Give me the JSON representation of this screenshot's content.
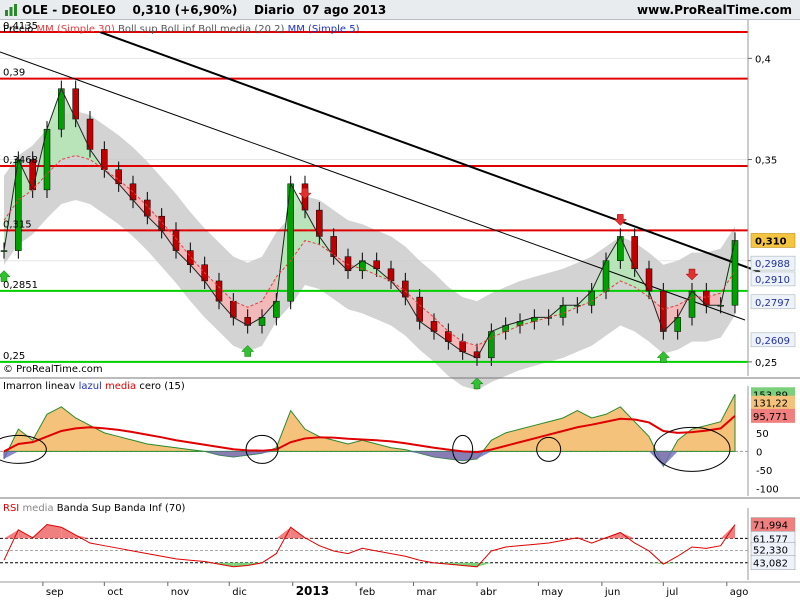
{
  "header": {
    "ticker": "OLE - DEOLEO",
    "last_price": "0,310 (+6,90%)",
    "period": "Diario",
    "date": "07 ago 2013",
    "site": "www.ProRealTime.com",
    "icon": "bar-chart-icon"
  },
  "colors": {
    "candle_up": "#00a000",
    "candle_down": "#c00000",
    "support": "#00d000",
    "resistance": "#e00000",
    "band": "#c8c8c8",
    "bull_fill": "#b6e6b6",
    "bear_fill": "#f4b6b6",
    "macd_hist": "#6c6cc0",
    "rsi": "#e00000"
  },
  "chart_data": [
    {
      "type": "candlestick",
      "title": "Precio",
      "legend": [
        "Precio",
        "MM (Simple 30)",
        "Boll sup",
        "Boll inf",
        "Boll media (20 2)",
        "MM (Simple 5)"
      ],
      "ylim": [
        0.245,
        0.415
      ],
      "y_ticks": [
        "0,4",
        "0,35",
        "0,30",
        "0,25"
      ],
      "x_ticks": [
        "sep",
        "oct",
        "nov",
        "dic",
        "2013",
        "feb",
        "mar",
        "abr",
        "may",
        "jun",
        "jul",
        "ago"
      ],
      "horizontal_levels": [
        {
          "value": 0.413,
          "label": "0,4135",
          "color": "red"
        },
        {
          "value": 0.39,
          "label": "0,39",
          "color": "red"
        },
        {
          "value": 0.3468,
          "label": "0,3468",
          "color": "red"
        },
        {
          "value": 0.315,
          "label": "0,315",
          "color": "red"
        },
        {
          "value": 0.2851,
          "label": "0,2851",
          "color": "green"
        },
        {
          "value": 0.25,
          "label": "0,25",
          "color": "green"
        }
      ],
      "right_labels": [
        {
          "value": 0.31,
          "label": "0,310",
          "style": "last"
        },
        {
          "value": 0.2988,
          "label": "0,2988"
        },
        {
          "value": 0.291,
          "label": "0,2910"
        },
        {
          "value": 0.2797,
          "label": "0,2797"
        },
        {
          "value": 0.2609,
          "label": "0,2609"
        }
      ],
      "series": [
        {
          "name": "Precio",
          "x": [
            "2012-08-13",
            "2012-08-20",
            "2012-08-27",
            "2012-09-03",
            "2012-09-10",
            "2012-09-17",
            "2012-09-24",
            "2012-10-01",
            "2012-10-08",
            "2012-10-15",
            "2012-10-22",
            "2012-10-29",
            "2012-11-05",
            "2012-11-12",
            "2012-11-19",
            "2012-11-26",
            "2012-12-03",
            "2012-12-10",
            "2012-12-17",
            "2012-12-24",
            "2012-12-31",
            "2013-01-07",
            "2013-01-14",
            "2013-01-21",
            "2013-01-28",
            "2013-02-04",
            "2013-02-11",
            "2013-02-18",
            "2013-02-25",
            "2013-03-04",
            "2013-03-11",
            "2013-03-18",
            "2013-03-25",
            "2013-04-01",
            "2013-04-08",
            "2013-04-15",
            "2013-04-22",
            "2013-04-29",
            "2013-05-06",
            "2013-05-13",
            "2013-05-20",
            "2013-05-27",
            "2013-06-03",
            "2013-06-10",
            "2013-06-17",
            "2013-06-24",
            "2013-07-01",
            "2013-07-08",
            "2013-07-15",
            "2013-07-22",
            "2013-07-29",
            "2013-08-05"
          ],
          "values": [
            0.305,
            0.35,
            0.335,
            0.365,
            0.385,
            0.37,
            0.355,
            0.345,
            0.338,
            0.33,
            0.322,
            0.315,
            0.305,
            0.298,
            0.29,
            0.28,
            0.272,
            0.268,
            0.272,
            0.28,
            0.338,
            0.325,
            0.312,
            0.302,
            0.295,
            0.3,
            0.296,
            0.29,
            0.282,
            0.27,
            0.265,
            0.26,
            0.255,
            0.252,
            0.265,
            0.268,
            0.27,
            0.272,
            0.272,
            0.278,
            0.278,
            0.285,
            0.3,
            0.312,
            0.296,
            0.285,
            0.265,
            0.272,
            0.285,
            0.278,
            0.278,
            0.31
          ]
        },
        {
          "name": "MM (Simple 30)",
          "values": [
            0.32,
            0.33,
            0.335,
            0.343,
            0.35,
            0.352,
            0.35,
            0.345,
            0.34,
            0.334,
            0.327,
            0.319,
            0.311,
            0.302,
            0.294,
            0.287,
            0.28,
            0.277,
            0.28,
            0.292,
            0.3,
            0.31,
            0.308,
            0.303,
            0.298,
            0.296,
            0.293,
            0.29,
            0.285,
            0.278,
            0.272,
            0.265,
            0.26,
            0.258,
            0.262,
            0.265,
            0.268,
            0.27,
            0.272,
            0.274,
            0.277,
            0.28,
            0.285,
            0.29,
            0.287,
            0.282,
            0.276,
            0.278,
            0.282,
            0.282,
            0.284,
            0.295
          ]
        }
      ]
    },
    {
      "type": "area",
      "title": "Imarron lineav lazul media cero (15)",
      "ylim": [
        -120,
        160
      ],
      "y_ticks": [
        "50",
        "0",
        "-50",
        "-100"
      ],
      "right_labels": [
        "153,89",
        "131,22",
        "95,771"
      ],
      "x": [
        "2012-08-13",
        "2012-08-20",
        "2012-08-27",
        "2012-09-03",
        "2012-09-10",
        "2012-09-17",
        "2012-09-24",
        "2012-10-01",
        "2012-10-08",
        "2012-10-15",
        "2012-10-22",
        "2012-10-29",
        "2012-11-05",
        "2012-11-12",
        "2012-11-19",
        "2012-11-26",
        "2012-12-03",
        "2012-12-10",
        "2012-12-17",
        "2012-12-24",
        "2012-12-31",
        "2013-01-07",
        "2013-01-14",
        "2013-01-21",
        "2013-01-28",
        "2013-02-04",
        "2013-02-11",
        "2013-02-18",
        "2013-02-25",
        "2013-03-04",
        "2013-03-11",
        "2013-03-18",
        "2013-03-25",
        "2013-04-01",
        "2013-04-08",
        "2013-04-15",
        "2013-04-22",
        "2013-04-29",
        "2013-05-06",
        "2013-05-13",
        "2013-05-20",
        "2013-05-27",
        "2013-06-03",
        "2013-06-10",
        "2013-06-17",
        "2013-06-24",
        "2013-07-01",
        "2013-07-08",
        "2013-07-15",
        "2013-07-22",
        "2013-07-29",
        "2013-08-05"
      ],
      "series": [
        {
          "name": "Imarron",
          "values": [
            -20,
            60,
            30,
            100,
            120,
            90,
            70,
            50,
            40,
            30,
            20,
            15,
            10,
            5,
            0,
            -10,
            -15,
            -10,
            -5,
            10,
            110,
            60,
            40,
            30,
            20,
            30,
            20,
            10,
            5,
            -5,
            -15,
            -20,
            -25,
            -20,
            30,
            50,
            60,
            70,
            80,
            90,
            110,
            90,
            100,
            120,
            80,
            40,
            -40,
            30,
            60,
            70,
            80,
            153.89
          ]
        },
        {
          "name": "media",
          "values": [
            0,
            20,
            25,
            40,
            55,
            62,
            65,
            62,
            58,
            52,
            45,
            38,
            30,
            24,
            18,
            12,
            6,
            3,
            2,
            5,
            25,
            35,
            38,
            37,
            34,
            32,
            30,
            27,
            22,
            16,
            10,
            5,
            0,
            -2,
            5,
            15,
            25,
            35,
            45,
            55,
            65,
            72,
            80,
            88,
            86,
            78,
            55,
            50,
            52,
            56,
            62,
            95.771
          ]
        }
      ]
    },
    {
      "type": "line",
      "title": "RSI media Banda Sup Banda Inf (70)",
      "ylim": [
        30,
        80
      ],
      "right_labels": [
        "71,994",
        "61,577",
        "52,330",
        "43,082"
      ],
      "x": [
        "2012-08-13",
        "2012-08-20",
        "2012-08-27",
        "2012-09-03",
        "2012-09-10",
        "2012-09-17",
        "2012-09-24",
        "2012-10-01",
        "2012-10-08",
        "2012-10-15",
        "2012-10-22",
        "2012-10-29",
        "2012-11-05",
        "2012-11-12",
        "2012-11-19",
        "2012-11-26",
        "2012-12-03",
        "2012-12-10",
        "2012-12-17",
        "2012-12-24",
        "2012-12-31",
        "2013-01-07",
        "2013-01-14",
        "2013-01-21",
        "2013-01-28",
        "2013-02-04",
        "2013-02-11",
        "2013-02-18",
        "2013-02-25",
        "2013-03-04",
        "2013-03-11",
        "2013-03-18",
        "2013-03-25",
        "2013-04-01",
        "2013-04-08",
        "2013-04-15",
        "2013-04-22",
        "2013-04-29",
        "2013-05-06",
        "2013-05-13",
        "2013-05-20",
        "2013-05-27",
        "2013-06-03",
        "2013-06-10",
        "2013-06-17",
        "2013-06-24",
        "2013-07-01",
        "2013-07-08",
        "2013-07-15",
        "2013-07-22",
        "2013-07-29",
        "2013-08-05"
      ],
      "series": [
        {
          "name": "RSI",
          "values": [
            45,
            68,
            62,
            72,
            70,
            64,
            58,
            56,
            54,
            52,
            50,
            48,
            46,
            45,
            44,
            42,
            40,
            41,
            43,
            50,
            70,
            62,
            56,
            52,
            50,
            54,
            52,
            50,
            48,
            45,
            43,
            42,
            41,
            40,
            52,
            55,
            56,
            57,
            58,
            60,
            62,
            58,
            62,
            66,
            58,
            52,
            42,
            48,
            55,
            54,
            56,
            71.994
          ]
        },
        {
          "name": "Banda Sup",
          "values": [
            61.577
          ]
        },
        {
          "name": "media",
          "values": [
            52.33
          ]
        },
        {
          "name": "Banda Inf",
          "values": [
            43.082
          ]
        }
      ]
    }
  ],
  "footer": {
    "copyright": "© ProRealTime.com",
    "year_tick": "2013"
  }
}
